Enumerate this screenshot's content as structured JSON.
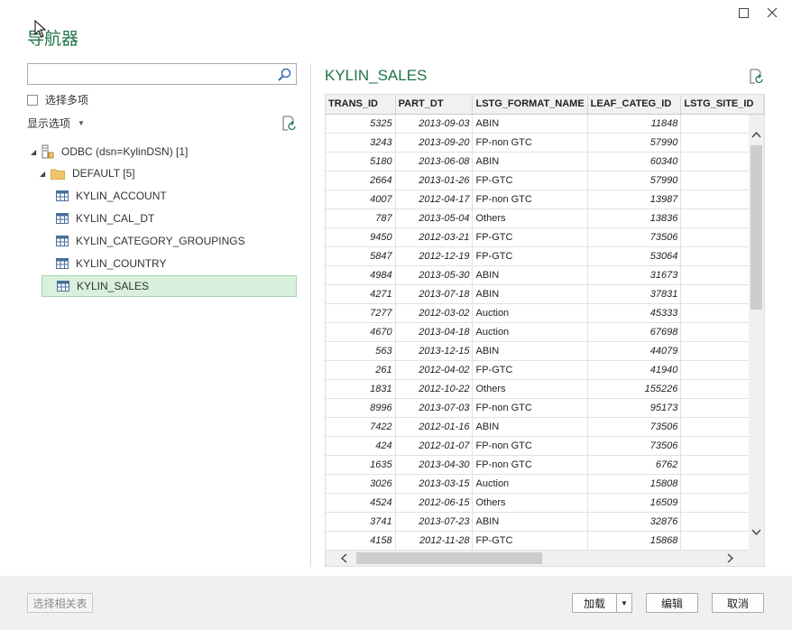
{
  "window": {
    "title": "导航器"
  },
  "search": {
    "value": "",
    "placeholder": ""
  },
  "select_multiple_label": "选择多项",
  "display_options_label": "显示选项",
  "tree": {
    "source": {
      "label": "ODBC (dsn=KylinDSN) [1]"
    },
    "folder": {
      "label": "DEFAULT [5]"
    },
    "tables": [
      {
        "label": "KYLIN_ACCOUNT",
        "selected": false
      },
      {
        "label": "KYLIN_CAL_DT",
        "selected": false
      },
      {
        "label": "KYLIN_CATEGORY_GROUPINGS",
        "selected": false
      },
      {
        "label": "KYLIN_COUNTRY",
        "selected": false
      },
      {
        "label": "KYLIN_SALES",
        "selected": true
      }
    ]
  },
  "preview": {
    "title": "KYLIN_SALES",
    "columns": [
      "TRANS_ID",
      "PART_DT",
      "LSTG_FORMAT_NAME",
      "LEAF_CATEG_ID",
      "LSTG_SITE_ID"
    ],
    "rows": [
      [
        "5325",
        "2013-09-03",
        "ABIN",
        "11848",
        ""
      ],
      [
        "3243",
        "2013-09-20",
        "FP-non GTC",
        "57990",
        ""
      ],
      [
        "5180",
        "2013-06-08",
        "ABIN",
        "60340",
        ""
      ],
      [
        "2664",
        "2013-01-26",
        "FP-GTC",
        "57990",
        ""
      ],
      [
        "4007",
        "2012-04-17",
        "FP-non GTC",
        "13987",
        ""
      ],
      [
        "787",
        "2013-05-04",
        "Others",
        "13836",
        ""
      ],
      [
        "9450",
        "2012-03-21",
        "FP-GTC",
        "73506",
        ""
      ],
      [
        "5847",
        "2012-12-19",
        "FP-GTC",
        "53064",
        ""
      ],
      [
        "4984",
        "2013-05-30",
        "ABIN",
        "31673",
        ""
      ],
      [
        "4271",
        "2013-07-18",
        "ABIN",
        "37831",
        ""
      ],
      [
        "7277",
        "2012-03-02",
        "Auction",
        "45333",
        ""
      ],
      [
        "4670",
        "2013-04-18",
        "Auction",
        "67698",
        ""
      ],
      [
        "563",
        "2013-12-15",
        "ABIN",
        "44079",
        ""
      ],
      [
        "261",
        "2012-04-02",
        "FP-GTC",
        "41940",
        ""
      ],
      [
        "1831",
        "2012-10-22",
        "Others",
        "155226",
        ""
      ],
      [
        "8996",
        "2013-07-03",
        "FP-non GTC",
        "95173",
        ""
      ],
      [
        "7422",
        "2012-01-16",
        "ABIN",
        "73506",
        ""
      ],
      [
        "424",
        "2012-01-07",
        "FP-non GTC",
        "73506",
        ""
      ],
      [
        "1635",
        "2013-04-30",
        "FP-non GTC",
        "6762",
        ""
      ],
      [
        "3026",
        "2013-03-15",
        "Auction",
        "15808",
        ""
      ],
      [
        "4524",
        "2012-06-15",
        "Others",
        "16509",
        ""
      ],
      [
        "3741",
        "2013-07-23",
        "ABIN",
        "32876",
        ""
      ],
      [
        "4158",
        "2012-11-28",
        "FP-GTC",
        "15868",
        ""
      ]
    ]
  },
  "footer": {
    "select_related_label": "选择相关表",
    "load_label": "加载",
    "edit_label": "编辑",
    "cancel_label": "取消"
  },
  "icons": {
    "minimize": "minimize-icon",
    "maximize": "maximize-icon",
    "close": "close-icon",
    "search": "search-icon",
    "refresh": "refresh-icon",
    "database": "database-icon",
    "folder": "folder-icon",
    "table": "table-icon"
  },
  "colors": {
    "accent": "#217346",
    "selected_bg": "#d9f0dd",
    "folder": "#f0c36d"
  }
}
